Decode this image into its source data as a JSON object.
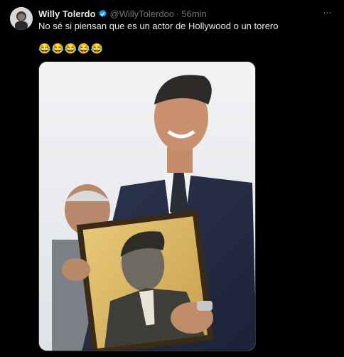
{
  "tweet": {
    "author_name": "Willy Tolerdo",
    "handle": "@WillyTolerdoo",
    "separator": "·",
    "time": "56min",
    "more_label": "···",
    "text": "No sé si piensan que es un actor de Hollywood o un torero",
    "emojis": [
      "😂",
      "😂",
      "😂",
      "😂",
      "😂"
    ],
    "verified": true,
    "colors": {
      "verified": "#1d9bf0",
      "muted": "#71767b",
      "text": "#e7e9ea",
      "background": "#000000"
    }
  }
}
